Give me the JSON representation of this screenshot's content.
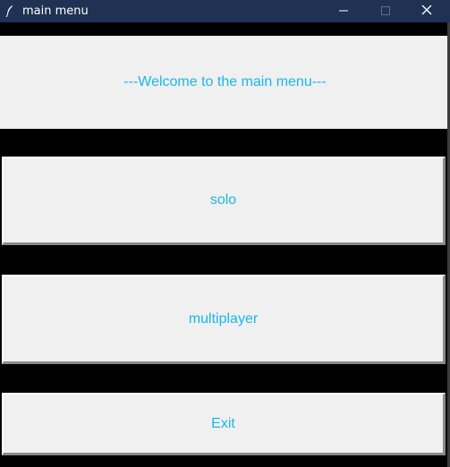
{
  "window": {
    "title": "main menu",
    "app_icon": "feather-icon",
    "controls": {
      "minimize_icon": "minimize-icon",
      "maximize_icon": "maximize-icon",
      "close_icon": "close-icon"
    },
    "titlebar_color": "#1f3254"
  },
  "main": {
    "welcome_text": "---Welcome to the main menu---",
    "buttons": {
      "solo": "solo",
      "multiplayer": "multiplayer",
      "exit": "Exit"
    },
    "text_color": "#1ab7ea",
    "panel_color": "#f0f0f0",
    "background_color": "#000000"
  }
}
